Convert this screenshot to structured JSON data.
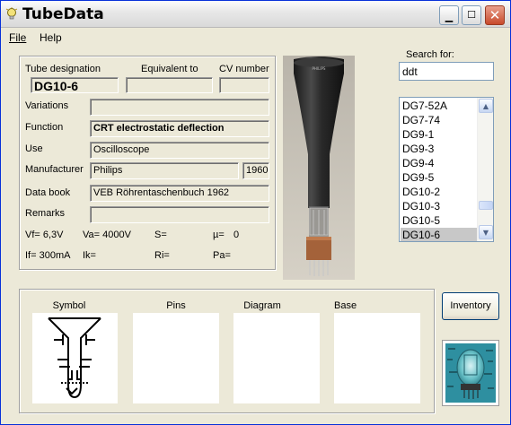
{
  "window": {
    "title": "TubeData",
    "icon": "bulb-icon",
    "controls": {
      "minimize": "minimize-icon",
      "maximize": "maximize-icon",
      "close": "close-icon"
    }
  },
  "menu": {
    "file": "File",
    "help": "Help"
  },
  "header": {
    "designation_label": "Tube designation",
    "designation_value": "DG10-6",
    "equivalent_label": "Equivalent to",
    "equivalent_value": "",
    "cv_label": "CV number",
    "cv_value": ""
  },
  "details": {
    "variations_label": "Variations",
    "variations_value": "",
    "function_label": "Function",
    "function_value": "CRT electrostatic deflection",
    "use_label": "Use",
    "use_value": "Oscilloscope",
    "manufacturer_label": "Manufacturer",
    "manufacturer_value": "Philips",
    "year_value": "1960",
    "databook_label": "Data book",
    "databook_value": "VEB Röhrentaschenbuch 1962",
    "remarks_label": "Remarks",
    "remarks_value": ""
  },
  "params": {
    "vf": "Vf= 6,3V",
    "va": "Va= 4000V",
    "s": "S=",
    "mu_label": "µ=",
    "mu_value": "0",
    "if": "If= 300mA",
    "ik": "Ik=",
    "ri": "Ri=",
    "pa": "Pa="
  },
  "search": {
    "label": "Search for:",
    "value": "ddt"
  },
  "tube_list": {
    "items": [
      "DG7-52A",
      "DG7-74",
      "DG9-1",
      "DG9-3",
      "DG9-4",
      "DG9-5",
      "DG10-2",
      "DG10-3",
      "DG10-5",
      "DG10-6"
    ],
    "selected": "DG10-6",
    "scroll_position": 0.85
  },
  "panels": {
    "symbol": "Symbol",
    "pins": "Pins",
    "diagram": "Diagram",
    "base": "Base"
  },
  "inventory_button": "Inventory"
}
